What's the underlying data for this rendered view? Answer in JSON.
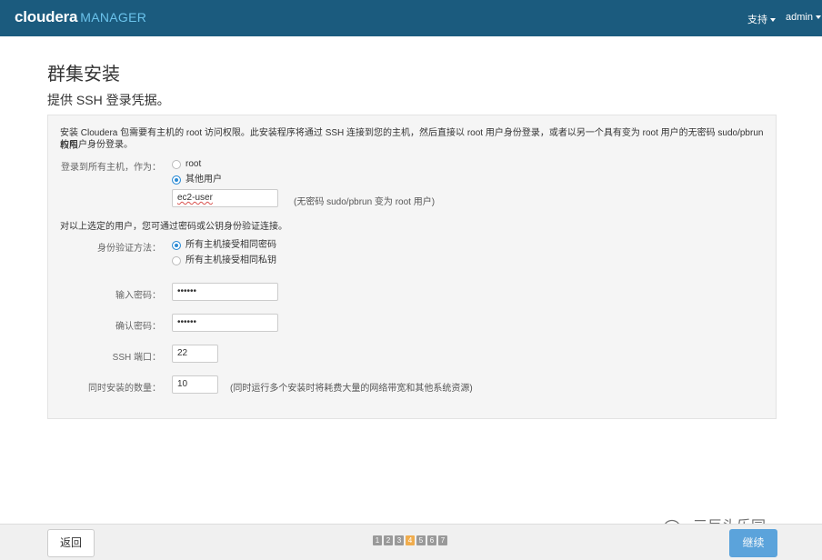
{
  "navbar": {
    "brand": "cloudera",
    "product": "MANAGER",
    "support_label": "支持",
    "user_label": "admin"
  },
  "page": {
    "title": "群集安装",
    "subtitle": "提供 SSH 登录凭据。"
  },
  "form": {
    "intro_line1": "安装 Cloudera 包需要有主机的 root 访问权限。此安装程序将通过 SSH 连接到您的主机，然后直接以 root 用户身份登录，或者以另一个具有变为 root 用户的无密码 sudo/pbrun 权限",
    "intro_line2": "的用户身份登录。",
    "login_label": "登录到所有主机，作为：",
    "login_options": [
      "root",
      "其他用户"
    ],
    "login_selected": "其他用户",
    "username_value": "ec2-user",
    "username_hint": "(无密码 sudo/pbrun 变为 root 用户)",
    "auth_intro": "对以上选定的用户，您可通过密码或公钥身份验证连接。",
    "auth_label": "身份验证方法：",
    "auth_options": [
      "所有主机接受相同密码",
      "所有主机接受相同私钥"
    ],
    "auth_selected": "所有主机接受相同密码",
    "password_label": "输入密码：",
    "password_value": "••••••",
    "confirm_label": "确认密码：",
    "confirm_value": "••••••",
    "ssh_port_label": "SSH 端口：",
    "ssh_port_value": "22",
    "concurrent_label": "同时安装的数量：",
    "concurrent_value": "10",
    "concurrent_hint": "(同时运行多个安装时将耗费大量的网络带宽和其他系统资源)"
  },
  "footer": {
    "back_label": "返回",
    "steps": [
      "1",
      "2",
      "3",
      "4",
      "5",
      "6",
      "7"
    ],
    "active_step": "4",
    "continue_label": "继续"
  },
  "watermark": {
    "text": "三巨头乐园",
    "icon": "wechat-icon"
  },
  "colors": {
    "navbar": "#1b5b7e",
    "accent": "#2a8ad4",
    "active_step": "#f0ad4e"
  }
}
